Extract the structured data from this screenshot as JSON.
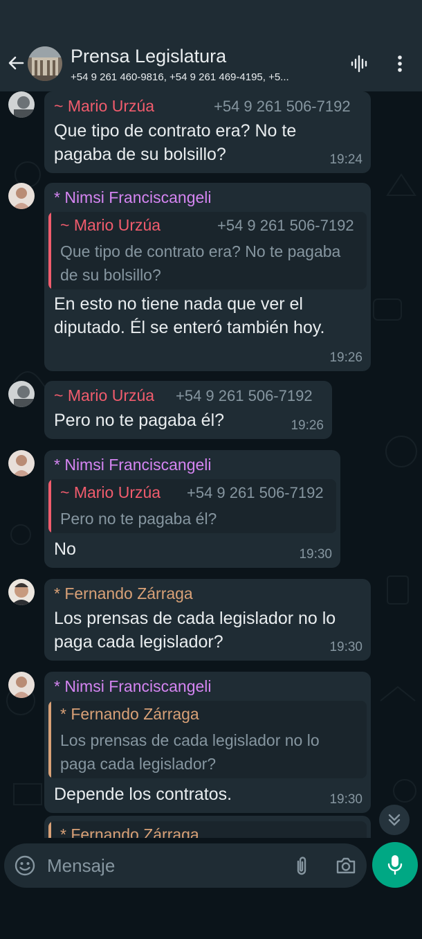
{
  "header": {
    "title": "Prensa Legislatura",
    "subtitle": "+54 9 261 460-9816, +54 9 261 469-4195, +5..."
  },
  "messages": [
    {
      "sender": "~ Mario Urzúa",
      "phone": "+54 9 261 506-7192",
      "text": "Que tipo de contrato era? No te pagaba de su bolsillo?",
      "time": "19:24"
    },
    {
      "sender": "* Nimsi Franciscangeli",
      "quote": {
        "sender": "~ Mario Urzúa",
        "phone": "+54 9 261 506-7192",
        "text": "Que tipo de contrato era? No te pagaba de su bolsillo?"
      },
      "text": "En esto no tiene nada que ver el diputado. Él se enteró también hoy.",
      "time": "19:26"
    },
    {
      "sender": "~ Mario Urzúa",
      "phone": "+54 9 261 506-7192",
      "text": "Pero no te pagaba él?",
      "time": "19:26"
    },
    {
      "sender": "* Nimsi Franciscangeli",
      "quote": {
        "sender": "~ Mario Urzúa",
        "phone": "+54 9 261 506-7192",
        "text": "Pero no te pagaba él?"
      },
      "text": "No",
      "time": "19:30"
    },
    {
      "sender": "* Fernando Zárraga",
      "text": "Los prensas de cada legislador no lo paga cada legislador?",
      "time": "19:30"
    },
    {
      "sender": "* Nimsi Franciscangeli",
      "quote": {
        "sender": "* Fernando Zárraga",
        "text": "Los prensas de cada legislador no lo paga cada legislador?"
      },
      "text": "Depende los contratos.",
      "time": "19:30"
    },
    {
      "quote": {
        "sender": "* Fernando Zárraga"
      }
    }
  ],
  "input": {
    "placeholder": "Mensaje"
  },
  "icons": {
    "back": "arrow-left-icon",
    "audio": "audio-waveform-icon",
    "more": "more-vertical-icon",
    "scroll": "double-chevron-down-icon",
    "emoji": "emoji-icon",
    "attach": "paperclip-icon",
    "camera": "camera-icon",
    "mic": "microphone-icon"
  },
  "colors": {
    "background": "#0b141a",
    "bubble": "#1f2c34",
    "accent": "#00a884",
    "mario": "#f15c6d",
    "nimsi": "#d585f2",
    "fernando": "#d9a177"
  }
}
